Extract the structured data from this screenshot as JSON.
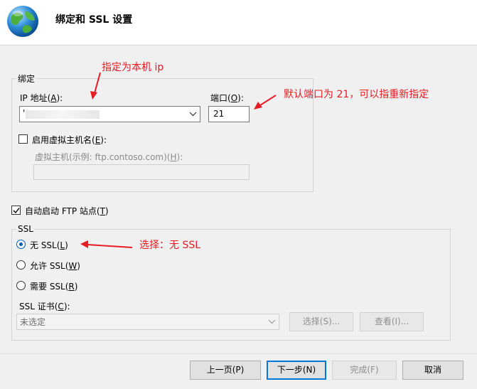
{
  "header": {
    "title": "绑定和 SSL 设置",
    "icon": "globe-icon"
  },
  "binding": {
    "group_title": "绑定",
    "ip_label": "IP 地址(",
    "ip_key": "A",
    "ip_label_end": "):",
    "ip_value": "'",
    "port_label": "端口(",
    "port_key": "O",
    "port_label_end": "):",
    "port_value": "21",
    "vhost_checkbox_label": "启用虚拟主机名(",
    "vhost_key": "E",
    "vhost_label_end": "):",
    "vhost_checked": false,
    "vhost_field_label": "虚拟主机(示例: ftp.contoso.com)(",
    "vhost_field_key": "H",
    "vhost_field_label_end": "):",
    "vhost_value": ""
  },
  "autostart": {
    "label": "自动启动 FTP 站点(",
    "key": "T",
    "label_end": ")",
    "checked": true
  },
  "ssl": {
    "group_title": "SSL",
    "options": [
      {
        "label": "无 SSL(",
        "key": "L",
        "end": ")",
        "checked": true
      },
      {
        "label": "允许 SSL(",
        "key": "W",
        "end": ")",
        "checked": false
      },
      {
        "label": "需要 SSL(",
        "key": "R",
        "end": ")",
        "checked": false
      }
    ],
    "cert_label": "SSL 证书(",
    "cert_key": "C",
    "cert_label_end": "):",
    "cert_value": "未选定",
    "select_button": "选择(S)...",
    "view_button": "查看(I)..."
  },
  "annotations": {
    "ip_note": "指定为本机 ip",
    "port_note": "默认端口为 21，可以指重新指定",
    "ssl_note": "选择：无 SSL"
  },
  "footer": {
    "prev_button": "上一页(P)",
    "next_button": "下一步(N)",
    "finish_button": "完成(F)",
    "cancel_button": "取消"
  },
  "colors": {
    "annotation": "#e51c23",
    "accent": "#0078d7"
  }
}
